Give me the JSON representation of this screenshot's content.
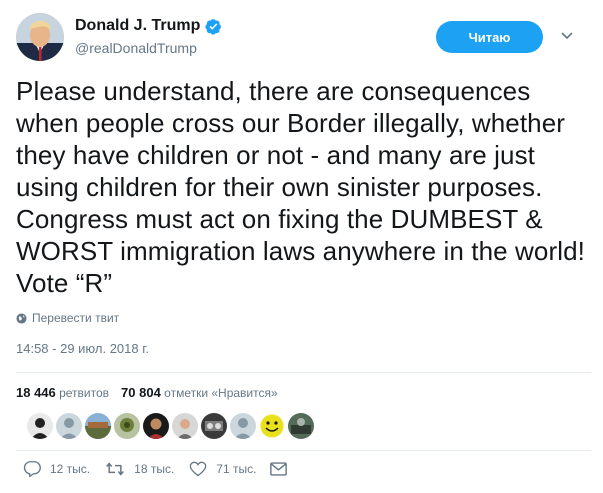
{
  "author": {
    "name": "Donald J. Trump",
    "handle": "@realDonaldTrump"
  },
  "follow_button": "Читаю",
  "tweet_text": "Please understand, there are consequences when people cross our Border illegally, whether they have children or not - and many are just using children for their own sinister purposes. Congress must act on fixing the DUMBEST & WORST immigration laws anywhere in the world! Vote “R”",
  "translate_link": "Перевести твит",
  "timestamp": "14:58 - 29 июл. 2018 г.",
  "stats": {
    "retweets_count": "18 446",
    "retweets_label": "ретвитов",
    "likes_count": "70 804",
    "likes_label": "отметки «Нравится»"
  },
  "actions": {
    "replies": "12 тыс.",
    "retweets": "18 тыс.",
    "likes": "71 тыс."
  },
  "colors": {
    "accent": "#1da1f2",
    "secondary_text": "#657786",
    "primary_text": "#14171a"
  }
}
